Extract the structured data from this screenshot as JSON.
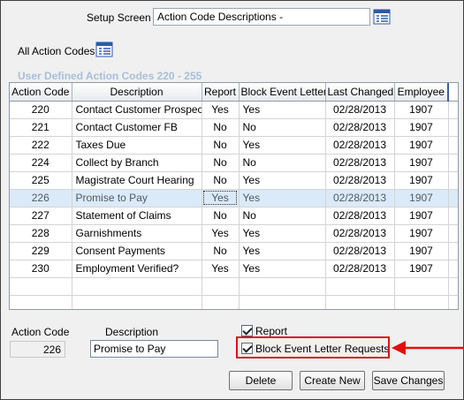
{
  "setup": {
    "label": "Setup Screen",
    "value": "Action Code Descriptions -"
  },
  "all_codes": {
    "label": "All Action Codes"
  },
  "section_title": "User Defined Action Codes 220 - 255",
  "grid": {
    "headers": [
      "Action Code",
      "Description",
      "Report",
      "Block Event Letter",
      "Last Changed",
      "Employee"
    ],
    "rows": [
      {
        "code": "220",
        "desc": "Contact Customer Prospect",
        "report": "Yes",
        "block": "Yes",
        "changed": "02/28/2013",
        "emp": "1907"
      },
      {
        "code": "221",
        "desc": "Contact Customer FB",
        "report": "No",
        "block": "No",
        "changed": "02/28/2013",
        "emp": "1907"
      },
      {
        "code": "222",
        "desc": "Taxes Due",
        "report": "No",
        "block": "Yes",
        "changed": "02/28/2013",
        "emp": "1907"
      },
      {
        "code": "224",
        "desc": "Collect by Branch",
        "report": "No",
        "block": "No",
        "changed": "02/28/2013",
        "emp": "1907"
      },
      {
        "code": "225",
        "desc": "Magistrate Court Hearing",
        "report": "No",
        "block": "Yes",
        "changed": "02/28/2013",
        "emp": "1907"
      },
      {
        "code": "226",
        "desc": "Promise to Pay",
        "report": "Yes",
        "block": "Yes",
        "changed": "02/28/2013",
        "emp": "1907"
      },
      {
        "code": "227",
        "desc": "Statement of Claims",
        "report": "No",
        "block": "No",
        "changed": "02/28/2013",
        "emp": "1907"
      },
      {
        "code": "228",
        "desc": "Garnishments",
        "report": "Yes",
        "block": "Yes",
        "changed": "02/28/2013",
        "emp": "1907"
      },
      {
        "code": "229",
        "desc": "Consent Payments",
        "report": "No",
        "block": "Yes",
        "changed": "02/28/2013",
        "emp": "1907"
      },
      {
        "code": "230",
        "desc": "Employment Verified?",
        "report": "Yes",
        "block": "Yes",
        "changed": "02/28/2013",
        "emp": "1907"
      }
    ]
  },
  "form": {
    "code_label": "Action Code",
    "code_value": "226",
    "desc_label": "Description",
    "desc_value": "Promise to Pay",
    "report_label": "Report",
    "report_checked": true,
    "block_label": "Block Event Letter Requests",
    "block_checked": true
  },
  "buttons": {
    "delete": "Delete",
    "create_new": "Create New",
    "save_changes": "Save Changes"
  },
  "colors": {
    "annotation_red": "#e01010",
    "selected_row": "#dbeaf8",
    "section_title": "#a7bfd8"
  }
}
